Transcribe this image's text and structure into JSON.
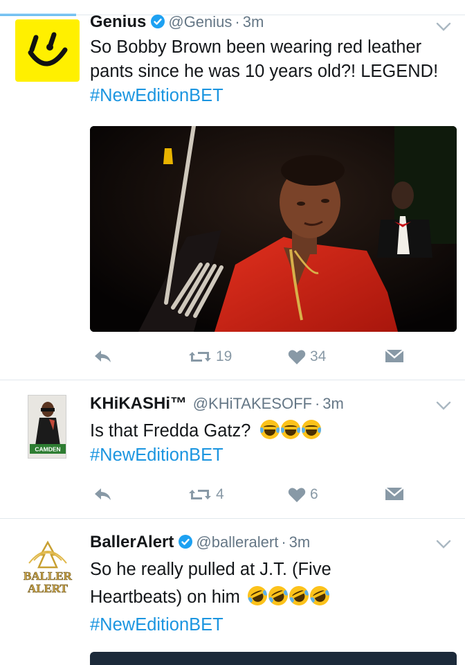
{
  "tweets": [
    {
      "name": "Genius",
      "verified": true,
      "handle": "@Genius",
      "time": "3m",
      "text": "So Bobby Brown been wearing red leather pants since he was 10 years old?! LEGEND!",
      "hashtag": "#NewEditionBET",
      "retweets": "19",
      "likes": "34",
      "avatar_icon": "genius-logo"
    },
    {
      "name": "KHiKASHi™",
      "verified": false,
      "handle": "@KHiTAKESOFF",
      "time": "3m",
      "text": "Is that Fredda Gatz?",
      "emoji": "😂😂😂",
      "hashtag": "#NewEditionBET",
      "retweets": "4",
      "likes": "6",
      "avatar_caption": "CAMDEN"
    },
    {
      "name": "BallerAlert",
      "verified": true,
      "handle": "@balleralert",
      "time": "3m",
      "text_line1": "So he really pulled at J.T. (Five",
      "text_line2": "Heartbeats) on him",
      "emoji": "🤣🤣🤣🤣",
      "hashtag": "#NewEditionBET",
      "avatar_caption": "BALLER ALERT"
    }
  ],
  "separator": "·",
  "colors": {
    "accent": "#1da1f2",
    "hashtag": "#1b95e0",
    "muted": "#8899a6",
    "handle": "#657786",
    "genius_yellow": "#fff000",
    "verified": "#1da1f2"
  },
  "icons": [
    "reply-icon",
    "retweet-icon",
    "heart-icon",
    "direct-message-icon",
    "chevron-down-icon",
    "verified-badge-icon"
  ]
}
